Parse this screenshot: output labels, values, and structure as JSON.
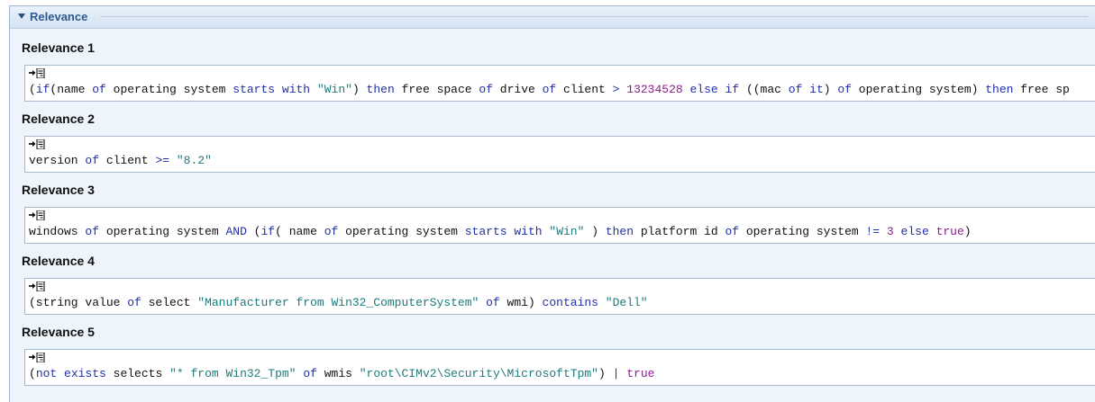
{
  "panel": {
    "title": "Relevance"
  },
  "colors": {
    "keyword": "#1f2fa8",
    "string": "#1b7c7c",
    "literal": "#8a1f8a",
    "text": "#111111"
  },
  "icons": {
    "section_toggle": "collapse-triangle-icon",
    "box_toggle": "format-toggle-icon"
  },
  "relevances": [
    {
      "label": "Relevance 1",
      "tokens": [
        {
          "t": "(",
          "c": "p"
        },
        {
          "t": "if",
          "c": "k"
        },
        {
          "t": "(name ",
          "c": "p"
        },
        {
          "t": "of",
          "c": "k"
        },
        {
          "t": " operating system ",
          "c": "p"
        },
        {
          "t": "starts with",
          "c": "k"
        },
        {
          "t": " ",
          "c": "p"
        },
        {
          "t": "\"Win\"",
          "c": "s"
        },
        {
          "t": ") ",
          "c": "p"
        },
        {
          "t": "then",
          "c": "k"
        },
        {
          "t": " free space ",
          "c": "p"
        },
        {
          "t": "of",
          "c": "k"
        },
        {
          "t": " drive ",
          "c": "p"
        },
        {
          "t": "of",
          "c": "k"
        },
        {
          "t": " client ",
          "c": "p"
        },
        {
          "t": ">",
          "c": "k"
        },
        {
          "t": " ",
          "c": "p"
        },
        {
          "t": "13234528",
          "c": "n"
        },
        {
          "t": " ",
          "c": "p"
        },
        {
          "t": "else",
          "c": "k"
        },
        {
          "t": " ",
          "c": "p"
        },
        {
          "t": "if",
          "c": "k"
        },
        {
          "t": " ((mac ",
          "c": "p"
        },
        {
          "t": "of",
          "c": "k"
        },
        {
          "t": " ",
          "c": "p"
        },
        {
          "t": "it",
          "c": "k"
        },
        {
          "t": ") ",
          "c": "p"
        },
        {
          "t": "of",
          "c": "k"
        },
        {
          "t": " operating system) ",
          "c": "p"
        },
        {
          "t": "then",
          "c": "k"
        },
        {
          "t": " free sp",
          "c": "p"
        }
      ]
    },
    {
      "label": "Relevance 2",
      "tokens": [
        {
          "t": "version ",
          "c": "p"
        },
        {
          "t": "of",
          "c": "k"
        },
        {
          "t": " client ",
          "c": "p"
        },
        {
          "t": ">=",
          "c": "k"
        },
        {
          "t": " ",
          "c": "p"
        },
        {
          "t": "\"8.2\"",
          "c": "s"
        }
      ]
    },
    {
      "label": "Relevance 3",
      "tokens": [
        {
          "t": "windows ",
          "c": "p"
        },
        {
          "t": "of",
          "c": "k"
        },
        {
          "t": " operating system ",
          "c": "p"
        },
        {
          "t": "AND",
          "c": "k"
        },
        {
          "t": " (",
          "c": "p"
        },
        {
          "t": "if",
          "c": "k"
        },
        {
          "t": "( name ",
          "c": "p"
        },
        {
          "t": "of",
          "c": "k"
        },
        {
          "t": " operating system ",
          "c": "p"
        },
        {
          "t": "starts with",
          "c": "k"
        },
        {
          "t": " ",
          "c": "p"
        },
        {
          "t": "\"Win\"",
          "c": "s"
        },
        {
          "t": " ) ",
          "c": "p"
        },
        {
          "t": "then",
          "c": "k"
        },
        {
          "t": " platform id ",
          "c": "p"
        },
        {
          "t": "of",
          "c": "k"
        },
        {
          "t": " operating system ",
          "c": "p"
        },
        {
          "t": "!=",
          "c": "k"
        },
        {
          "t": " ",
          "c": "p"
        },
        {
          "t": "3",
          "c": "n"
        },
        {
          "t": " ",
          "c": "p"
        },
        {
          "t": "else",
          "c": "k"
        },
        {
          "t": " ",
          "c": "p"
        },
        {
          "t": "true",
          "c": "n"
        },
        {
          "t": ")",
          "c": "p"
        }
      ]
    },
    {
      "label": "Relevance 4",
      "tokens": [
        {
          "t": "(string value ",
          "c": "p"
        },
        {
          "t": "of",
          "c": "k"
        },
        {
          "t": " select ",
          "c": "p"
        },
        {
          "t": "\"Manufacturer from Win32_ComputerSystem\"",
          "c": "s"
        },
        {
          "t": " ",
          "c": "p"
        },
        {
          "t": "of",
          "c": "k"
        },
        {
          "t": " wmi) ",
          "c": "p"
        },
        {
          "t": "contains",
          "c": "k"
        },
        {
          "t": " ",
          "c": "p"
        },
        {
          "t": "\"Dell\"",
          "c": "s"
        }
      ]
    },
    {
      "label": "Relevance 5",
      "tokens": [
        {
          "t": "(",
          "c": "p"
        },
        {
          "t": "not",
          "c": "k"
        },
        {
          "t": " ",
          "c": "p"
        },
        {
          "t": "exists",
          "c": "k"
        },
        {
          "t": " selects ",
          "c": "p"
        },
        {
          "t": "\"* from Win32_Tpm\"",
          "c": "s"
        },
        {
          "t": " ",
          "c": "p"
        },
        {
          "t": "of",
          "c": "k"
        },
        {
          "t": " wmis ",
          "c": "p"
        },
        {
          "t": "\"root\\CIMv2\\Security\\MicrosoftTpm\"",
          "c": "s"
        },
        {
          "t": ") ",
          "c": "p"
        },
        {
          "t": "|",
          "c": "k"
        },
        {
          "t": " ",
          "c": "p"
        },
        {
          "t": "true",
          "c": "n"
        }
      ]
    }
  ]
}
